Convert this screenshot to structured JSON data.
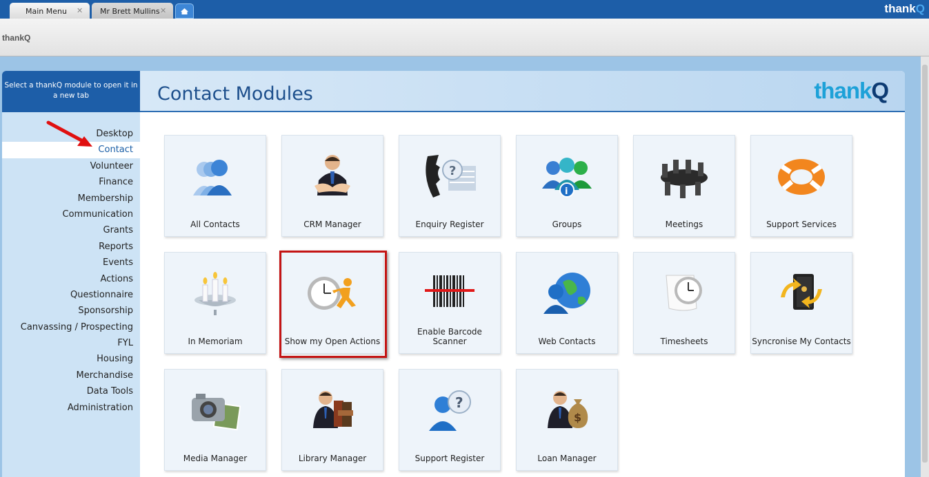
{
  "tabs": [
    {
      "label": "Main Menu"
    },
    {
      "label": "Mr Brett Mullins"
    }
  ],
  "brand_top": {
    "part1": "thank",
    "part2": "Q"
  },
  "toolbar": {
    "title": "thankQ"
  },
  "sidebar": {
    "header": "Select a thankQ module to open it in a new tab",
    "items": [
      {
        "label": "Desktop"
      },
      {
        "label": "Contact"
      },
      {
        "label": "Volunteer"
      },
      {
        "label": "Finance"
      },
      {
        "label": "Membership"
      },
      {
        "label": "Communication"
      },
      {
        "label": "Grants"
      },
      {
        "label": "Reports"
      },
      {
        "label": "Events"
      },
      {
        "label": "Actions"
      },
      {
        "label": "Questionnaire"
      },
      {
        "label": "Sponsorship"
      },
      {
        "label": "Canvassing / Prospecting"
      },
      {
        "label": "FYL"
      },
      {
        "label": "Housing"
      },
      {
        "label": "Merchandise"
      },
      {
        "label": "Data Tools"
      },
      {
        "label": "Administration"
      }
    ]
  },
  "main": {
    "title": "Contact Modules",
    "logo": {
      "part1": "thank",
      "part2": "Q"
    },
    "modules": [
      {
        "label": "All Contacts",
        "icon": "people-icon"
      },
      {
        "label": "CRM Manager",
        "icon": "handshake-icon"
      },
      {
        "label": "Enquiry Register",
        "icon": "phone-question-icon"
      },
      {
        "label": "Groups",
        "icon": "groups-icon"
      },
      {
        "label": "Meetings",
        "icon": "meeting-table-icon"
      },
      {
        "label": "Support Services",
        "icon": "lifebuoy-icon"
      },
      {
        "label": "In Memoriam",
        "icon": "candles-icon"
      },
      {
        "label": "Show my Open Actions",
        "icon": "clock-runner-icon"
      },
      {
        "label": "Enable Barcode Scanner",
        "icon": "barcode-icon"
      },
      {
        "label": "Web Contacts",
        "icon": "globe-person-icon"
      },
      {
        "label": "Timesheets",
        "icon": "clock-sheet-icon"
      },
      {
        "label": "Syncronise My Contacts",
        "icon": "sync-book-icon"
      },
      {
        "label": "Media Manager",
        "icon": "camera-icon"
      },
      {
        "label": "Library Manager",
        "icon": "books-person-icon"
      },
      {
        "label": "Support Register",
        "icon": "person-question-icon"
      },
      {
        "label": "Loan Manager",
        "icon": "money-bag-icon"
      }
    ]
  },
  "colors": {
    "brand_blue": "#1d5ea8",
    "accent_cyan": "#1da1d8",
    "highlight_red": "#c41414"
  }
}
